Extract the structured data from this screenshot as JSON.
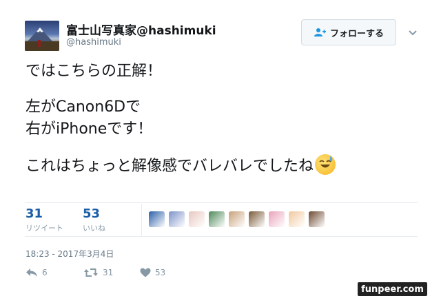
{
  "user": {
    "display_name": "富士山写真家@hashimuki",
    "handle": "@hashimuki"
  },
  "follow_button": {
    "label": "フォローする"
  },
  "tweet": {
    "lines": [
      "ではこちらの正解！",
      "左がCanon6Dで",
      "右がiPhoneです！",
      "これはちょっと解像感でバレバレでしたね"
    ],
    "emoji": "sweat-smile-emoji"
  },
  "stats": {
    "retweets": {
      "count": "31",
      "label": "リツイート"
    },
    "likes": {
      "count": "53",
      "label": "いいね"
    }
  },
  "likers": [
    {
      "name": "liker-1",
      "color": "#2b5fa8"
    },
    {
      "name": "liker-2",
      "color": "#7d92c9"
    },
    {
      "name": "liker-3",
      "color": "#e8c7c0"
    },
    {
      "name": "liker-4",
      "color": "#4f8a5a"
    },
    {
      "name": "liker-5",
      "color": "#c8a27a"
    },
    {
      "name": "liker-6",
      "color": "#7a5a3a"
    },
    {
      "name": "liker-7",
      "color": "#e9a3b9"
    },
    {
      "name": "liker-8",
      "color": "#f0c9a0"
    },
    {
      "name": "liker-9",
      "color": "#6e4a32"
    }
  ],
  "timestamp": "18:23 - 2017年3月4日",
  "actions": {
    "reply_count": "6",
    "retweet_count": "31",
    "like_count": "53"
  },
  "watermark": "funpeer.com",
  "colors": {
    "accent": "#1b5ea8",
    "muted": "#657786",
    "divider": "#e6ecf0"
  }
}
